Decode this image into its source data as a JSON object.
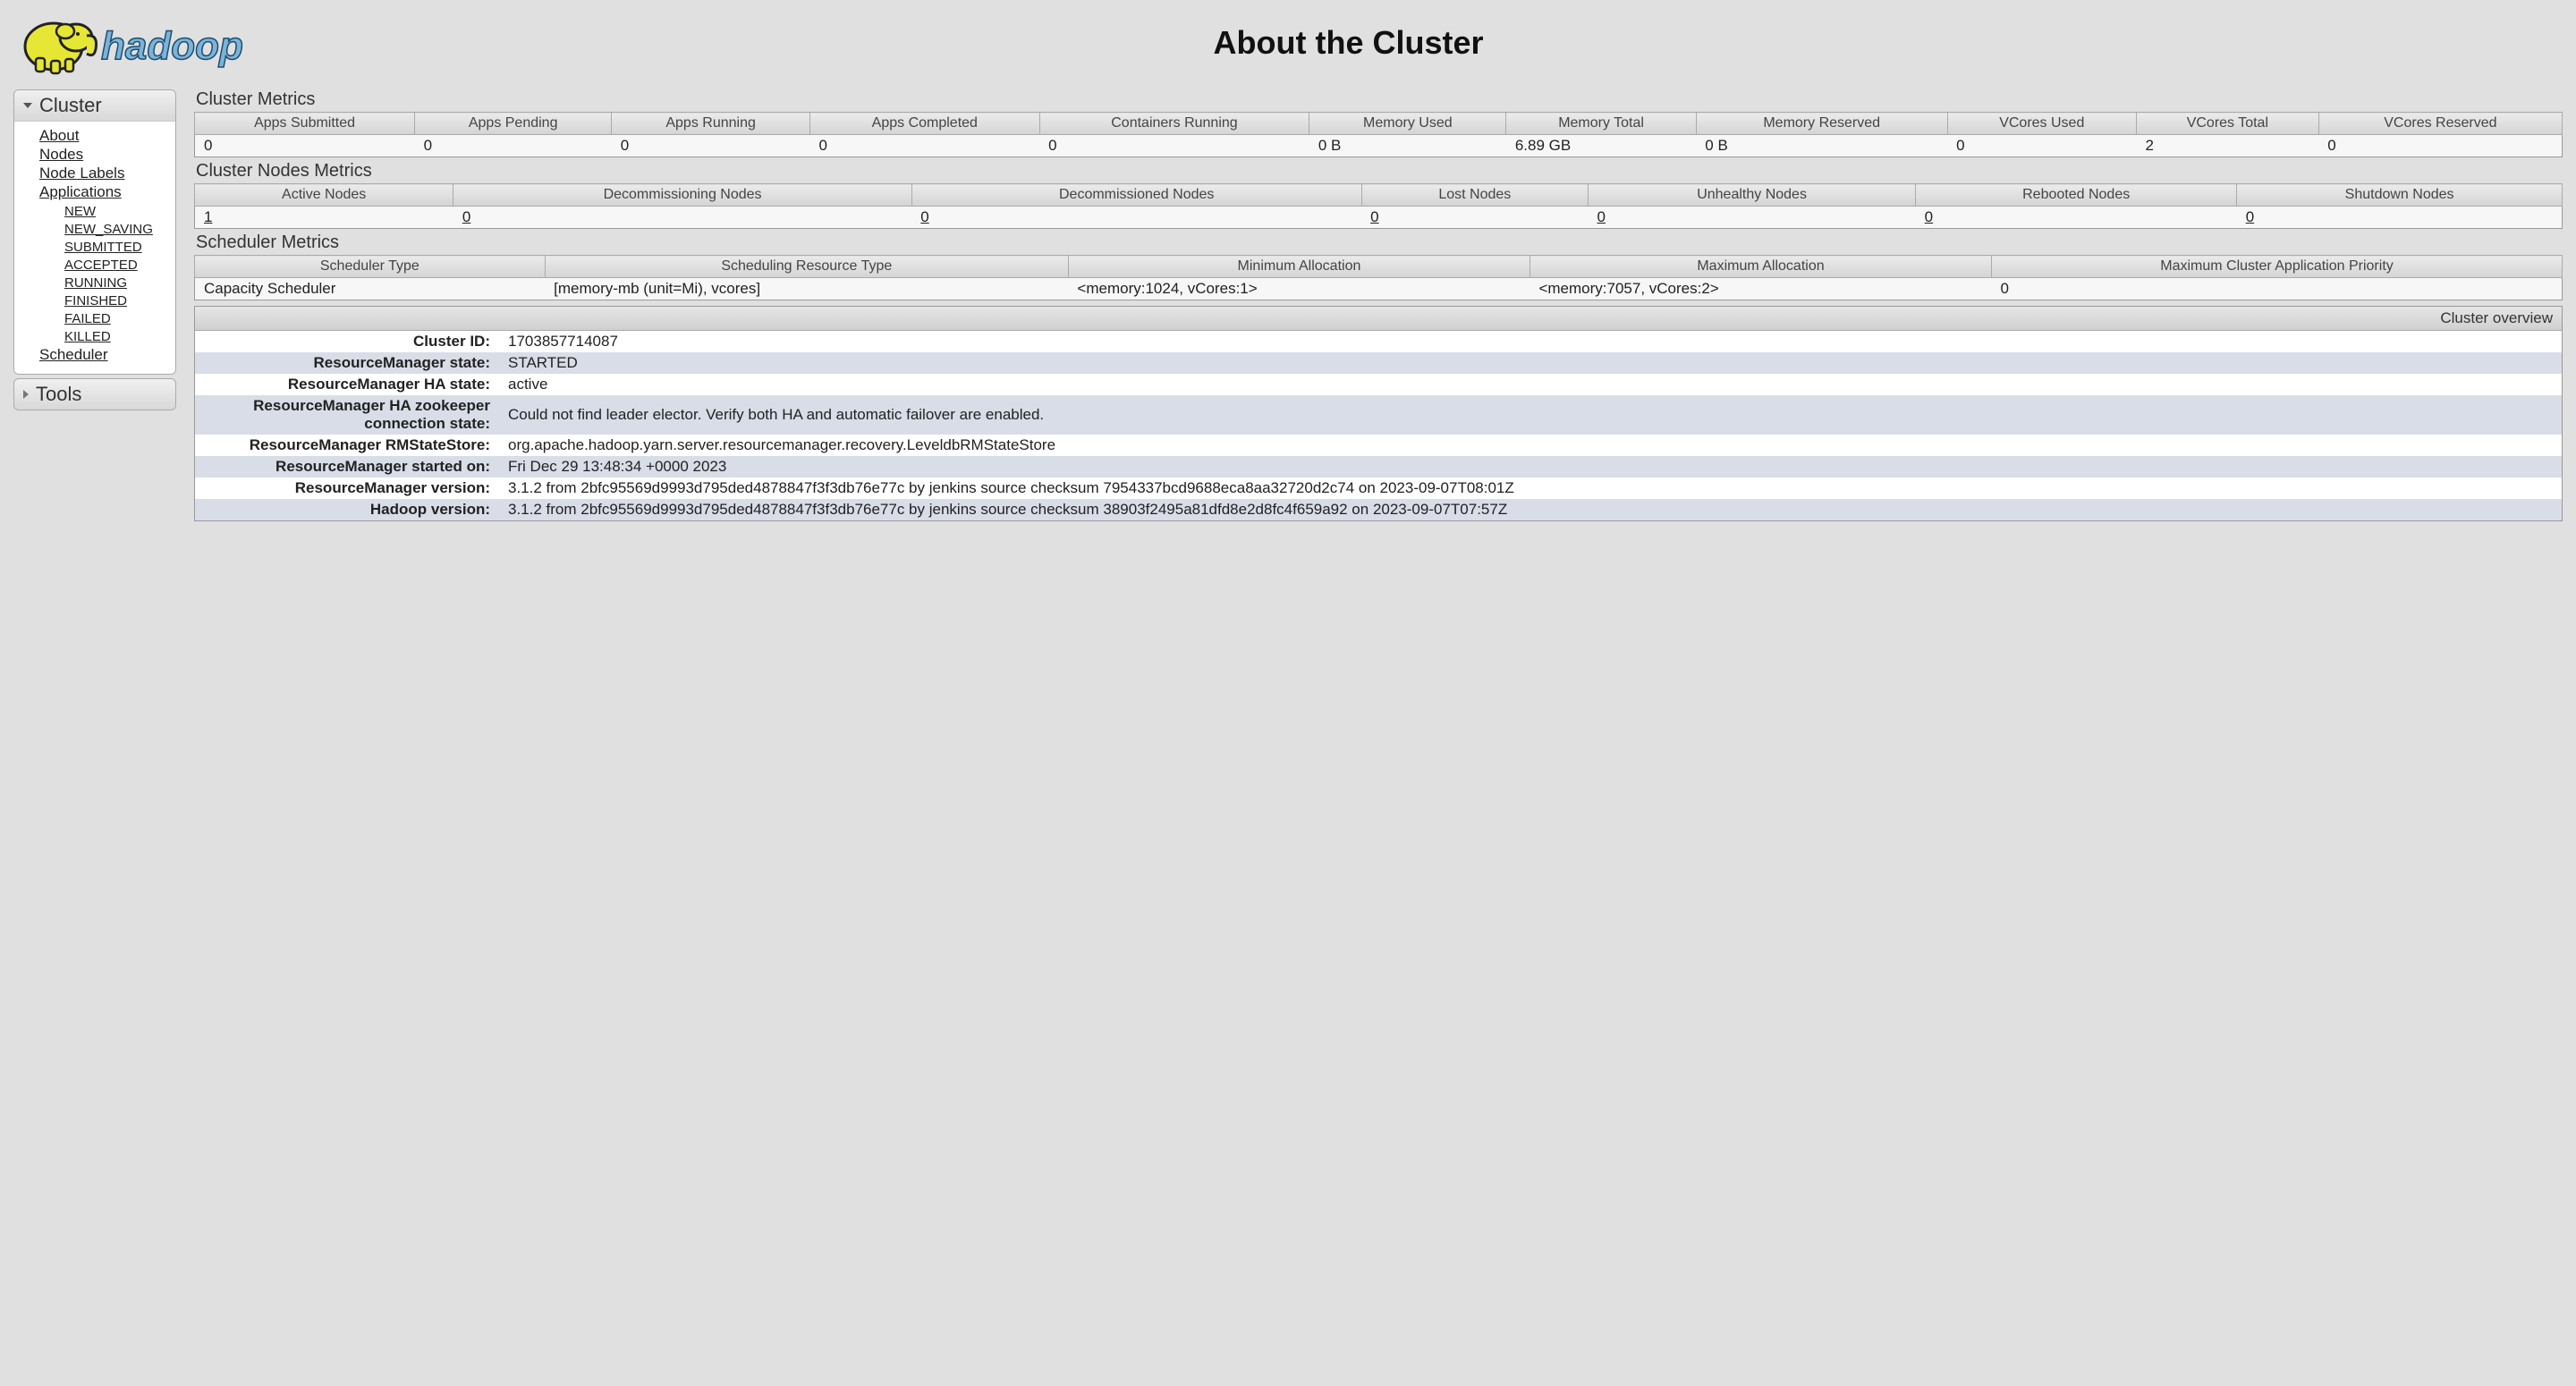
{
  "page_title": "About the Cluster",
  "sidebar": {
    "cluster_label": "Cluster",
    "tools_label": "Tools",
    "links": {
      "about": "About",
      "nodes": "Nodes",
      "node_labels": "Node Labels",
      "applications": "Applications",
      "scheduler": "Scheduler"
    },
    "app_states": [
      "NEW",
      "NEW_SAVING",
      "SUBMITTED",
      "ACCEPTED",
      "RUNNING",
      "FINISHED",
      "FAILED",
      "KILLED"
    ]
  },
  "cluster_metrics": {
    "title": "Cluster Metrics",
    "headers": [
      "Apps Submitted",
      "Apps Pending",
      "Apps Running",
      "Apps Completed",
      "Containers Running",
      "Memory Used",
      "Memory Total",
      "Memory Reserved",
      "VCores Used",
      "VCores Total",
      "VCores Reserved"
    ],
    "values": [
      "0",
      "0",
      "0",
      "0",
      "0",
      "0 B",
      "6.89 GB",
      "0 B",
      "0",
      "2",
      "0"
    ]
  },
  "nodes_metrics": {
    "title": "Cluster Nodes Metrics",
    "headers": [
      "Active Nodes",
      "Decommissioning Nodes",
      "Decommissioned Nodes",
      "Lost Nodes",
      "Unhealthy Nodes",
      "Rebooted Nodes",
      "Shutdown Nodes"
    ],
    "values": [
      "1",
      "0",
      "0",
      "0",
      "0",
      "0",
      "0"
    ]
  },
  "scheduler_metrics": {
    "title": "Scheduler Metrics",
    "headers": [
      "Scheduler Type",
      "Scheduling Resource Type",
      "Minimum Allocation",
      "Maximum Allocation",
      "Maximum Cluster Application Priority"
    ],
    "values": [
      "Capacity Scheduler",
      "[memory-mb (unit=Mi), vcores]",
      "<memory:1024, vCores:1>",
      "<memory:7057, vCores:2>",
      "0"
    ]
  },
  "overview": {
    "title": "Cluster overview",
    "rows": [
      {
        "k": "Cluster ID:",
        "v": "1703857714087"
      },
      {
        "k": "ResourceManager state:",
        "v": "STARTED"
      },
      {
        "k": "ResourceManager HA state:",
        "v": "active"
      },
      {
        "k": "ResourceManager HA zookeeper connection state:",
        "v": "Could not find leader elector. Verify both HA and automatic failover are enabled."
      },
      {
        "k": "ResourceManager RMStateStore:",
        "v": "org.apache.hadoop.yarn.server.resourcemanager.recovery.LeveldbRMStateStore"
      },
      {
        "k": "ResourceManager started on:",
        "v": "Fri Dec 29 13:48:34 +0000 2023"
      },
      {
        "k": "ResourceManager version:",
        "v": "3.1.2 from 2bfc95569d9993d795ded4878847f3f3db76e77c by jenkins source checksum 7954337bcd9688eca8aa32720d2c74 on 2023-09-07T08:01Z"
      },
      {
        "k": "Hadoop version:",
        "v": "3.1.2 from 2bfc95569d9993d795ded4878847f3f3db76e77c by jenkins source checksum 38903f2495a81dfd8e2d8fc4f659a92 on 2023-09-07T07:57Z"
      }
    ]
  }
}
